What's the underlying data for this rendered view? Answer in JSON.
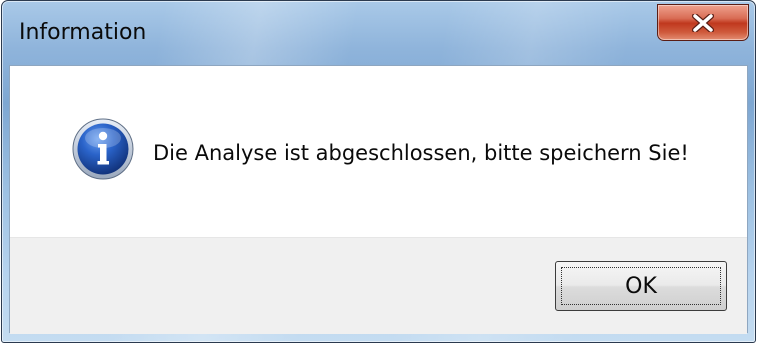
{
  "dialog": {
    "title": "Information",
    "message": "Die Analyse ist abgeschlossen, bitte speichern Sie!",
    "ok_label": "OK",
    "icon": "info-icon",
    "close_icon": "close-icon"
  },
  "colors": {
    "close_button_red": "#c0381e",
    "info_icon_blue": "#1f56b8",
    "button_area_bg": "#f0f0f0"
  }
}
